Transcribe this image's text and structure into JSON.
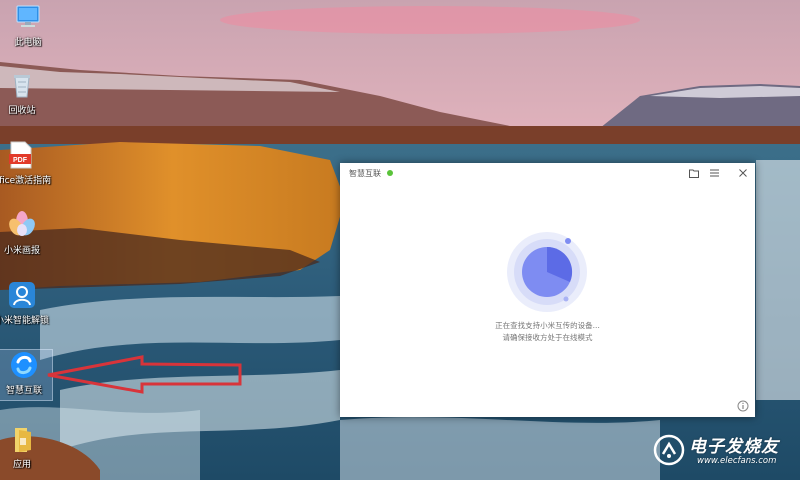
{
  "desktop": {
    "icons": [
      {
        "label": "此电脑",
        "icon": "computer-icon"
      },
      {
        "label": "回收站",
        "icon": "recycle-bin-icon"
      },
      {
        "label": "Office激活指南",
        "icon": "pdf-file-icon"
      },
      {
        "label": "小米画报",
        "icon": "flower-icon"
      },
      {
        "label": "小米智能解锁",
        "icon": "lock-person-icon"
      },
      {
        "label": "智慧互联",
        "icon": "smart-connect-icon",
        "selected": true
      },
      {
        "label": "应用",
        "icon": "folder-icon"
      }
    ]
  },
  "window": {
    "title": "智慧互联",
    "status_color": "#5ac33a",
    "toolbar": {
      "folder": "folder-icon",
      "menu": "menu-icon",
      "close": "close-icon"
    },
    "scan": {
      "line1": "正在查找支持小米互传的设备...",
      "line2": "请确保接收方处于在线模式"
    },
    "info_icon": "info-icon"
  },
  "watermark": {
    "title": "电子发烧友",
    "url": "www.elecfans.com"
  },
  "colors": {
    "accent": "#6f7ef0",
    "arrow": "#d8343a"
  }
}
